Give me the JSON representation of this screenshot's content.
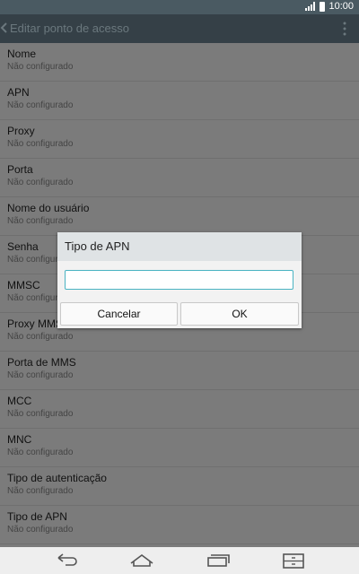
{
  "status_bar": {
    "time": "10:00",
    "signal_icon": "signal-icon",
    "battery_icon": "battery-icon"
  },
  "action_bar": {
    "title": "Editar ponto de acesso",
    "back_icon": "chevron-left-icon",
    "menu_icon": "overflow-menu-icon"
  },
  "settings": [
    {
      "title": "Nome",
      "value": "Não configurado"
    },
    {
      "title": "APN",
      "value": "Não configurado"
    },
    {
      "title": "Proxy",
      "value": "Não configurado"
    },
    {
      "title": "Porta",
      "value": "Não configurado"
    },
    {
      "title": "Nome do usuário",
      "value": "Não configurado"
    },
    {
      "title": "Senha",
      "value": "Não configurado"
    },
    {
      "title": "MMSC",
      "value": "Não configurado"
    },
    {
      "title": "Proxy MMS",
      "value": "Não configurado"
    },
    {
      "title": "Porta de MMS",
      "value": "Não configurado"
    },
    {
      "title": "MCC",
      "value": "Não configurado"
    },
    {
      "title": "MNC",
      "value": "Não configurado"
    },
    {
      "title": "Tipo de autenticação",
      "value": "Não configurado"
    },
    {
      "title": "Tipo de APN",
      "value": "Não configurado"
    }
  ],
  "dialog": {
    "title": "Tipo de APN",
    "input_value": "",
    "cancel_label": "Cancelar",
    "ok_label": "OK"
  },
  "nav_bar": {
    "icons": [
      "back-icon",
      "home-icon",
      "recent-apps-icon",
      "dual-window-icon"
    ]
  },
  "colors": {
    "accent": "#4ab3c2",
    "action_bar": "#354047",
    "status_bar": "#4a5a62"
  }
}
